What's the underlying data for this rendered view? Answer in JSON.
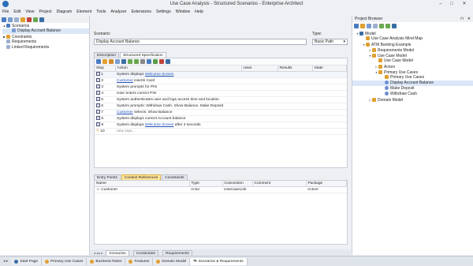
{
  "window": {
    "title": "Use Case Analysis - Structured Scenarios - Enterprise Architect",
    "min": "–",
    "max": "□",
    "close": "✕"
  },
  "menu": [
    "File",
    "Edit",
    "View",
    "Project",
    "Diagram",
    "Element",
    "Tools",
    "Analyzer",
    "Extensions",
    "Settings",
    "Window",
    "Help"
  ],
  "left_tree": {
    "items": [
      {
        "label": "Scenarios",
        "toggle": "▲"
      },
      {
        "label": "Display Account Balance",
        "toggle": ""
      },
      {
        "label": "Constraints",
        "toggle": "▶"
      },
      {
        "label": "Requirements",
        "toggle": ""
      },
      {
        "label": "Linked Requirements",
        "toggle": ""
      }
    ]
  },
  "scenario": {
    "label": "Scenario:",
    "value": "Display Account Balance",
    "type_label": "Type:",
    "type_value": "Basic Path",
    "type_arrow": "▾"
  },
  "tabs": [
    "Description",
    "Structured Specification"
  ],
  "steps": {
    "headers": [
      "Step",
      "Action",
      "Uses",
      "Results",
      "State"
    ],
    "rows": [
      {
        "n": "1",
        "pre": "System displays ",
        "link": "Welcome Screen",
        "post": ""
      },
      {
        "n": "2",
        "pre": "",
        "link": "Customer",
        "post": " inserts Card"
      },
      {
        "n": "3",
        "pre": "System prompts for PIN",
        "link": "",
        "post": ""
      },
      {
        "n": "4",
        "pre": "User enters correct PIN",
        "link": "",
        "post": ""
      },
      {
        "n": "5",
        "pre": "System authenticates user and logs access time and location",
        "link": "",
        "post": ""
      },
      {
        "n": "6",
        "pre": "System prompts: Withdraw Cash, Show Balance, Make Deposit",
        "link": "",
        "post": ""
      },
      {
        "n": "7",
        "pre": "",
        "link": "Customer",
        "post": " selects: Show Balance"
      },
      {
        "n": "8",
        "pre": "System displays current Account balance",
        "link": "",
        "post": ""
      },
      {
        "n": "9",
        "pre": "System displays ",
        "link": "Welcome Screen",
        "post": " after 3 seconds"
      }
    ],
    "new_step_number": "10",
    "new_step": "new step..."
  },
  "ctx_tabs": [
    "Entry Points",
    "Context References",
    "Constraints"
  ],
  "ctx": {
    "headers": [
      "Name",
      "Type",
      "Connection",
      "Comment",
      "Package"
    ],
    "rows": [
      {
        "name": "Customer",
        "type": "Actor",
        "connection": "UseCaseLink",
        "comment": "",
        "package": "Actors"
      }
    ]
  },
  "sub_tabs": [
    "Scenarios",
    "Constraints",
    "Requirements"
  ],
  "bottom_tabs": [
    "Start Page",
    "Primary Use Cases",
    "Business Rules",
    "Features",
    "Domain Model",
    "Scenarios & Requirements"
  ],
  "browser": {
    "title": "Project Browser",
    "pin": "⊓",
    "close": "✕",
    "items": [
      {
        "label": "Model",
        "toggle": "▾",
        "indent": 0,
        "icon": "#3a6ea5"
      },
      {
        "label": "Use Case Analysis Mind Map",
        "toggle": "",
        "indent": 1,
        "icon": "#e0a030"
      },
      {
        "label": "ATM Banking Example",
        "toggle": "▾",
        "indent": 1,
        "icon": "#e0a030"
      },
      {
        "label": "Requirements Model",
        "toggle": "▷",
        "indent": 2,
        "icon": "#e0a030"
      },
      {
        "label": "Use Case Model",
        "toggle": "▾",
        "indent": 2,
        "icon": "#e0a030"
      },
      {
        "label": "Use Case Model",
        "toggle": "",
        "indent": 3,
        "icon": "#e0a030"
      },
      {
        "label": "Actors",
        "toggle": "▷",
        "indent": 3,
        "icon": "#e0a030"
      },
      {
        "label": "Primary Use Cases",
        "toggle": "▾",
        "indent": 3,
        "icon": "#e0a030"
      },
      {
        "label": "Primary Use Cases",
        "toggle": "",
        "indent": 4,
        "icon": "#e0a030"
      },
      {
        "label": "Display Account Balance",
        "toggle": "",
        "indent": 4,
        "icon": "#6f8fd0",
        "selected": true
      },
      {
        "label": "Make Deposit",
        "toggle": "",
        "indent": 4,
        "icon": "#6f8fd0"
      },
      {
        "label": "Withdraw Cash",
        "toggle": "",
        "indent": 4,
        "icon": "#6f8fd0"
      },
      {
        "label": "Domain Model",
        "toggle": "▷",
        "indent": 2,
        "icon": "#e0a030"
      }
    ]
  }
}
